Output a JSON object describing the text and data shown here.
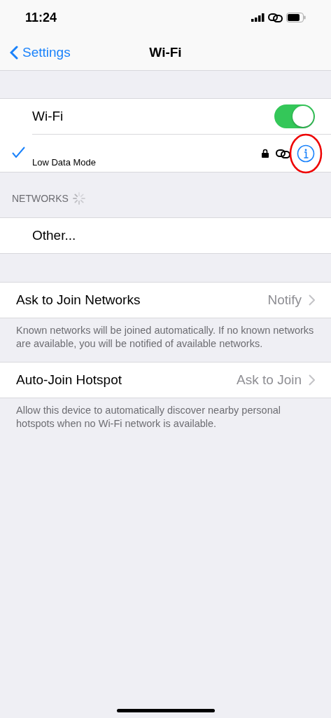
{
  "status_bar": {
    "time": "11:24"
  },
  "nav": {
    "back": "Settings",
    "title": "Wi-Fi"
  },
  "wifi": {
    "label": "Wi-Fi",
    "on": true
  },
  "current_network": {
    "selected": true,
    "subtitle": "Low Data Mode",
    "locked": true,
    "info_circled": true
  },
  "networks": {
    "header": "NETWORKS",
    "loading": true,
    "items": [
      {
        "label": "Other..."
      }
    ]
  },
  "settings": [
    {
      "label": "Ask to Join Networks",
      "value": "Notify",
      "footer": "Known networks will be joined automatically. If no known networks are available, you will be notified of available networks."
    },
    {
      "label": "Auto-Join Hotspot",
      "value": "Ask to Join",
      "footer": "Allow this device to automatically discover nearby personal hotspots when no Wi-Fi network is available."
    }
  ]
}
